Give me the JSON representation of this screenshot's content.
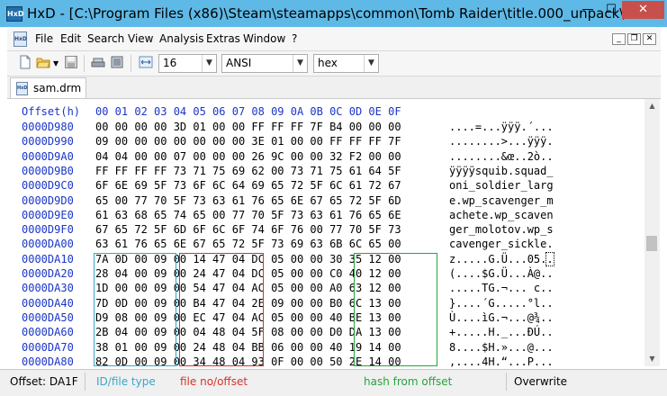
{
  "window": {
    "app_icon_text": "HxD",
    "title": "HxD - [C:\\Program Files (x86)\\Steam\\steamapps\\common\\Tomb Raider\\title.000_unpack\\...",
    "minimize": "—",
    "maximize": "☐",
    "close": "✕"
  },
  "menu": {
    "items": [
      "File",
      "Edit",
      "Search",
      "View",
      "Analysis",
      "Extras",
      "Window",
      "?"
    ],
    "mdi_minimize": "_",
    "mdi_restore": "❐",
    "mdi_close": "✕"
  },
  "toolbar": {
    "bytes_per_row": "16",
    "charset": "ANSI",
    "offset_base": "hex"
  },
  "tabs": [
    {
      "label": "sam.drm"
    }
  ],
  "hex": {
    "header_offset": "Offset(h)",
    "header_cols": "00 01 02 03 04 05 06 07 08 09 0A 0B 0C 0D 0E 0F",
    "rows": [
      {
        "offset": "0000D980",
        "bytes": "00 00 00 00 3D 01 00 00 FF FF FF 7F B4 00 00 00",
        "ascii": "....=...ÿÿÿ.´..."
      },
      {
        "offset": "0000D990",
        "bytes": "09 00 00 00 00 00 00 00 3E 01 00 00 FF FF FF 7F",
        "ascii": "........>...ÿÿÿ."
      },
      {
        "offset": "0000D9A0",
        "bytes": "04 04 00 00 07 00 00 00 26 9C 00 00 32 F2 00 00",
        "ascii": "........&œ..2ò.."
      },
      {
        "offset": "0000D9B0",
        "bytes": "FF FF FF FF 73 71 75 69 62 00 73 71 75 61 64 5F",
        "ascii": "ÿÿÿÿsquib.squad_"
      },
      {
        "offset": "0000D9C0",
        "bytes": "6F 6E 69 5F 73 6F 6C 64 69 65 72 5F 6C 61 72 67",
        "ascii": "oni_soldier_larg"
      },
      {
        "offset": "0000D9D0",
        "bytes": "65 00 77 70 5F 73 63 61 76 65 6E 67 65 72 5F 6D",
        "ascii": "e.wp_scavenger_m"
      },
      {
        "offset": "0000D9E0",
        "bytes": "61 63 68 65 74 65 00 77 70 5F 73 63 61 76 65 6E",
        "ascii": "achete.wp_scaven"
      },
      {
        "offset": "0000D9F0",
        "bytes": "67 65 72 5F 6D 6F 6C 6F 74 6F 76 00 77 70 5F 73",
        "ascii": "ger_molotov.wp_s"
      },
      {
        "offset": "0000DA00",
        "bytes": "63 61 76 65 6E 67 65 72 5F 73 69 63 6B 6C 65 00",
        "ascii": "cavenger_sickle."
      },
      {
        "offset": "0000DA10",
        "bytes": "7A 0D 00 09 00 14 47 04 DC 05 00 00 30 35 12 00",
        "ascii": "z.....G.Ü...05..",
        "cursor_col": 15
      },
      {
        "offset": "0000DA20",
        "bytes": "28 04 00 09 00 24 47 04 DC 05 00 00 C0 40 12 00",
        "ascii": "(....$G.Ü...À@.."
      },
      {
        "offset": "0000DA30",
        "bytes": "1D 00 00 09 00 54 47 04 AC 05 00 00 A0 63 12 00",
        "ascii": ".....TG.¬... c.."
      },
      {
        "offset": "0000DA40",
        "bytes": "7D 0D 00 09 00 B4 47 04 2E 09 00 00 B0 6C 13 00",
        "ascii": "}....´G.....°l.."
      },
      {
        "offset": "0000DA50",
        "bytes": "D9 08 00 09 00 EC 47 04 AC 05 00 00 40 BE 13 00",
        "ascii": "Ù....ìG.¬...@¾.."
      },
      {
        "offset": "0000DA60",
        "bytes": "2B 04 00 09 00 04 48 04 5F 08 00 00 D0 DA 13 00",
        "ascii": "+.....H._...ÐÚ.."
      },
      {
        "offset": "0000DA70",
        "bytes": "38 01 00 09 00 24 48 04 BB 06 00 00 40 19 14 00",
        "ascii": "8....$H.»...@..."
      },
      {
        "offset": "0000DA80",
        "bytes": "82 0D 00 09 00 34 48 04 93 0F 00 00 50 2E 14 00",
        "ascii": "‚....4H.“...P..."
      }
    ]
  },
  "annotations": {
    "id_label": "ID/file type",
    "file_label": "file no/offset",
    "hash_label": "hash from offset",
    "colors": {
      "id": "#3aa6c8",
      "file": "#d9322b",
      "hash": "#27a33d"
    }
  },
  "status": {
    "offset": "Offset: DA1F",
    "mode": "Overwrite"
  }
}
